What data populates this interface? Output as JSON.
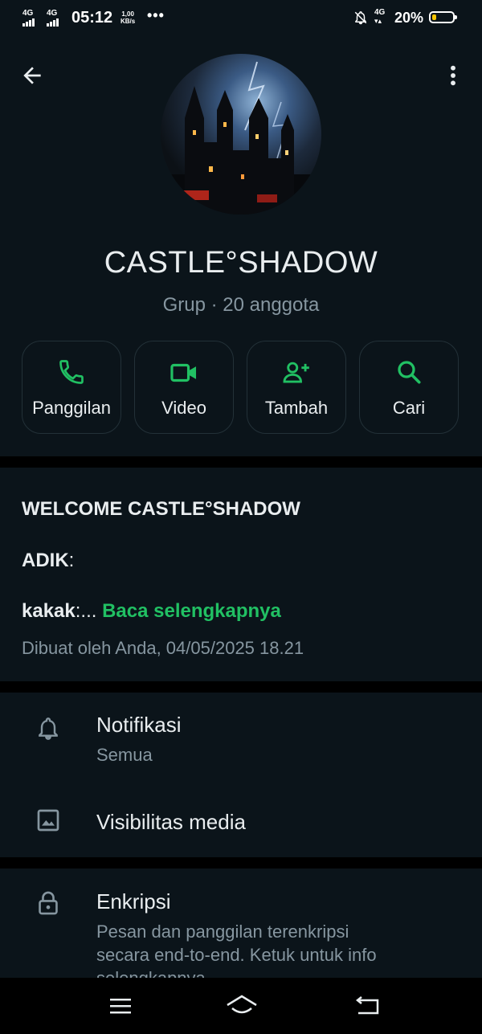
{
  "status_bar": {
    "signal_1": "4G",
    "signal_2": "4G",
    "time": "05:12",
    "speed_value": "1,00",
    "speed_unit": "KB/s",
    "more": "•••",
    "sim2": "4G",
    "battery": "20%",
    "battery_level": 0.2,
    "battery_color": "#f5c400"
  },
  "header": {
    "back_icon": "arrow-left-icon",
    "menu_icon": "more-vertical-icon"
  },
  "group": {
    "name": "CASTLE°SHADOW",
    "subtitle": "Grup · 20 anggota"
  },
  "actions": [
    {
      "label": "Panggilan",
      "icon": "phone-icon"
    },
    {
      "label": "Video",
      "icon": "video-icon"
    },
    {
      "label": "Tambah",
      "icon": "add-person-icon"
    },
    {
      "label": "Cari",
      "icon": "search-icon"
    }
  ],
  "description": {
    "title": "WELCOME CASTLE°SHADOW",
    "line_adik_bold": "ADIK",
    "line_adik_rest": ":",
    "line_kakak_bold": "kakak",
    "line_kakak_rest": ":... ",
    "read_more": "Baca selengkapnya",
    "created": "Dibuat oleh Anda, 04/05/2025 18.21"
  },
  "settings": {
    "notifications": {
      "title": "Notifikasi",
      "value": "Semua",
      "icon": "bell-icon"
    },
    "media_visibility": {
      "title": "Visibilitas media",
      "icon": "image-icon"
    },
    "encryption": {
      "title": "Enkripsi",
      "description_line1": "Pesan dan panggilan terenkripsi",
      "description_line2": "secara end-to-end. Ketuk untuk info",
      "description_line3": "selengkapnya.",
      "icon": "lock-icon"
    }
  },
  "nav_bar": {
    "menu_icon": "menu-icon",
    "home_icon": "home-icon",
    "back_icon": "back-icon"
  },
  "colors": {
    "accent": "#21c063",
    "background": "#0b141a",
    "divider": "#000000",
    "secondary_text": "#8696a0"
  }
}
